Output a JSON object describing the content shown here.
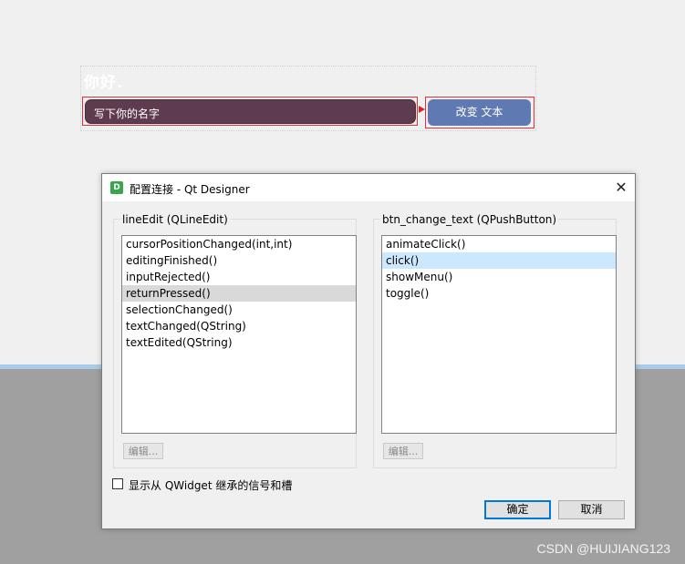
{
  "form": {
    "greeting": "你好.",
    "line_edit_placeholder": "写下你的名字",
    "change_button_label": "改变 文本"
  },
  "dialog": {
    "app_icon_letter": "D",
    "title": "配置连接 - Qt Designer",
    "close_glyph": "✕",
    "left_group": {
      "title": "lineEdit (QLineEdit)",
      "items": [
        "cursorPositionChanged(int,int)",
        "editingFinished()",
        "inputRejected()",
        "returnPressed()",
        "selectionChanged()",
        "textChanged(QString)",
        "textEdited(QString)"
      ],
      "selected_index": 3,
      "edit_label": "编辑..."
    },
    "right_group": {
      "title": "btn_change_text (QPushButton)",
      "items": [
        "animateClick()",
        "click()",
        "showMenu()",
        "toggle()"
      ],
      "selected_index": 1,
      "edit_label": "编辑..."
    },
    "inherit_checkbox": {
      "label": "显示从 QWidget 继承的信号和槽",
      "checked": false
    },
    "ok_label": "确定",
    "cancel_label": "取消"
  },
  "watermark": "CSDN @HUIJIANG123",
  "colors": {
    "line_edit_bg": "#5e3b4f",
    "button_bg": "#5f7ab3",
    "selection_border": "#e0303a",
    "list_selected_blue": "#cce8ff",
    "list_selected_gray": "#d9d9d9",
    "ok_border": "#0078d7"
  }
}
